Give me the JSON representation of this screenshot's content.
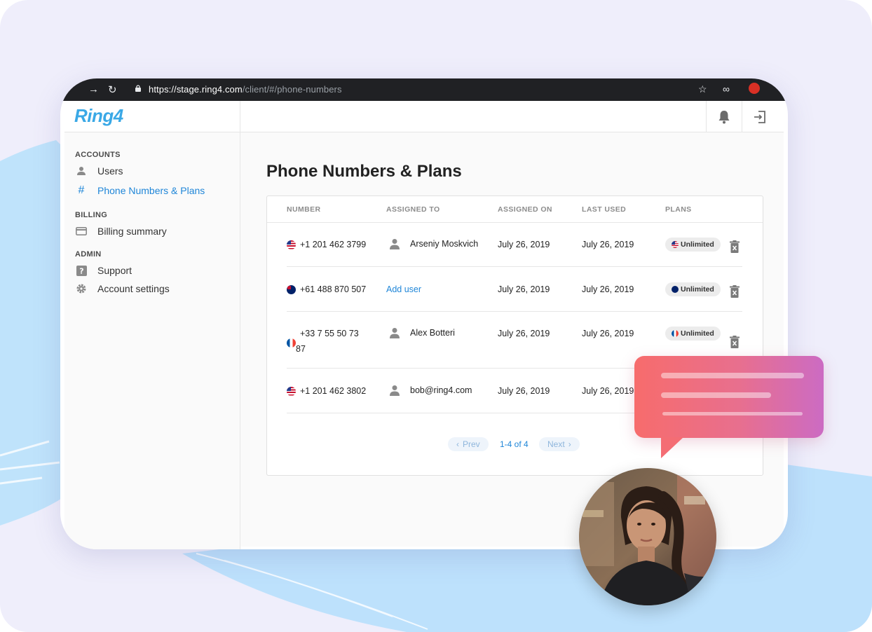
{
  "browser": {
    "url_host": "https://stage.ring4.com",
    "url_path": "/client/#/phone-numbers"
  },
  "app": {
    "logo": "Ring4"
  },
  "sidebar": {
    "sections": [
      {
        "title": "ACCOUNTS",
        "items": [
          {
            "label": "Users",
            "icon": "user-icon"
          },
          {
            "label": "Phone Numbers & Plans",
            "icon": "hash-icon",
            "active": true
          }
        ]
      },
      {
        "title": "BILLING",
        "items": [
          {
            "label": "Billing summary",
            "icon": "credit-card-icon"
          }
        ]
      },
      {
        "title": "ADMIN",
        "items": [
          {
            "label": "Support",
            "icon": "help-icon"
          },
          {
            "label": "Account settings",
            "icon": "gear-icon"
          }
        ]
      }
    ]
  },
  "main": {
    "title": "Phone Numbers & Plans",
    "columns": [
      "NUMBER",
      "ASSIGNED TO",
      "ASSIGNED ON",
      "LAST USED",
      "PLANS"
    ],
    "rows": [
      {
        "number": "+1 201 462 3799",
        "flag": "us",
        "assigned_to": "Arseniy Moskvich",
        "assigned_on": "July 26, 2019",
        "last_used": "July 26, 2019",
        "plan": "Unlimited"
      },
      {
        "number": "+61 488 870 507",
        "flag": "au",
        "assigned_to": "Add user",
        "assigned_on": "July 26, 2019",
        "last_used": "July 26, 2019",
        "plan": "Unlimited"
      },
      {
        "number_line1": "+33 7 55 50 73",
        "number_line2": "87",
        "flag": "fr",
        "assigned_to": "Alex Botteri",
        "assigned_on": "July 26, 2019",
        "last_used": "July 26, 2019",
        "plan": "Unlimited"
      },
      {
        "number": "+1 201 462 3802",
        "flag": "us",
        "assigned_to": "bob@ring4.com",
        "assigned_on": "July 26, 2019",
        "last_used": "July 26, 2019"
      }
    ],
    "pager": {
      "prev": "Prev",
      "info": "1-4 of 4",
      "next": "Next"
    }
  },
  "colors": {
    "accent": "#1f86d8",
    "logo": "#3aa8e6",
    "bubble_start": "#f76c6c",
    "bubble_end": "#cc6bc3",
    "background": "#efeefb"
  }
}
